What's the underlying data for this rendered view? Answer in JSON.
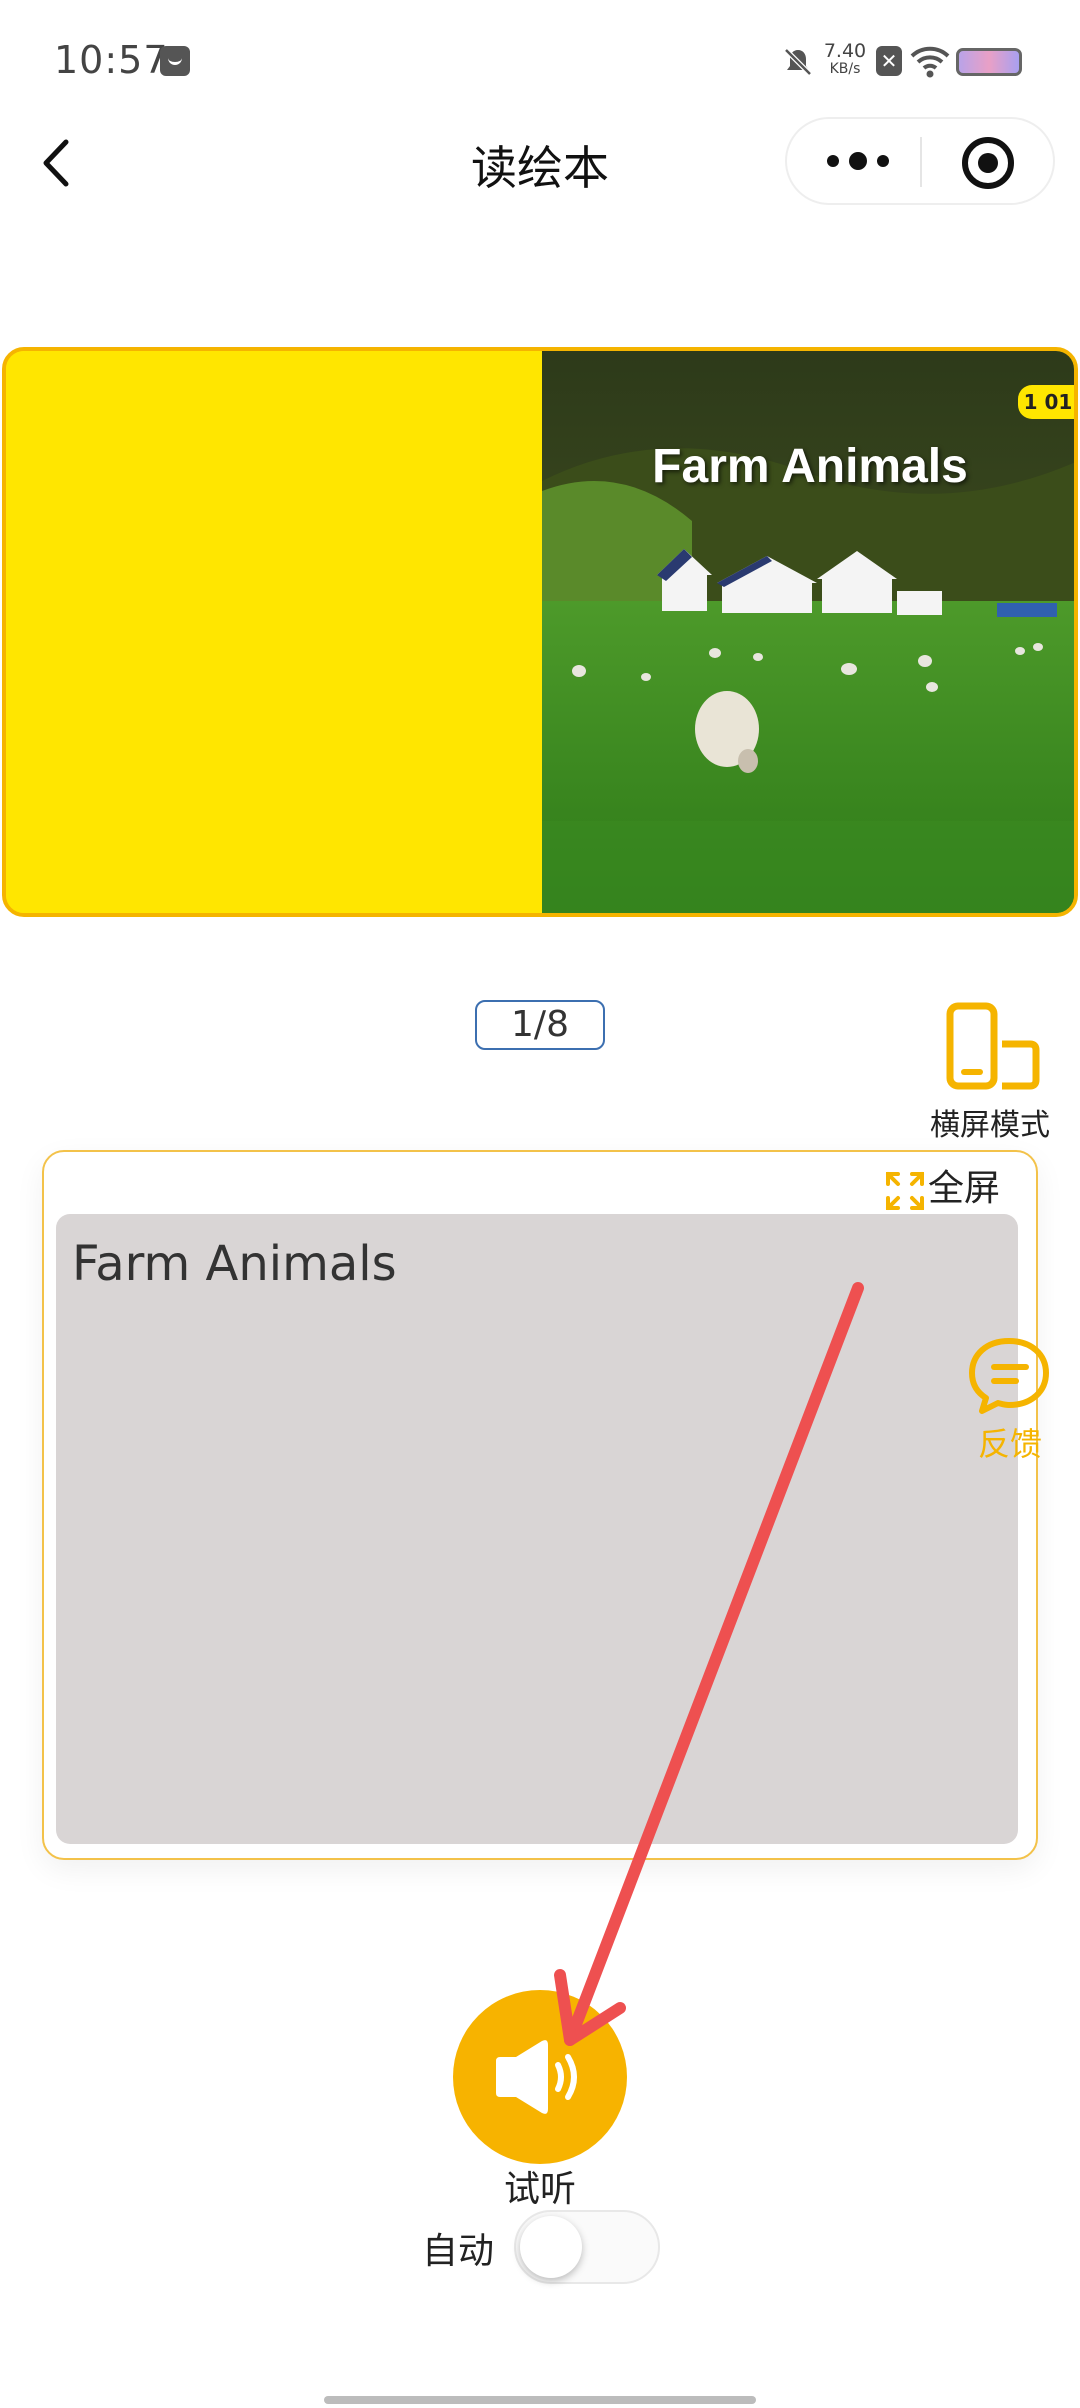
{
  "status_bar": {
    "time": "10:57",
    "network_speed_value": "7.40",
    "network_speed_unit": "KB/s",
    "icons": [
      "message-icon",
      "mute-bell-icon",
      "close-box-icon",
      "wifi-icon",
      "battery-icon"
    ]
  },
  "nav": {
    "title": "读绘本",
    "back_icon": "chevron-left-icon",
    "more_icon": "more-dots-icon",
    "close_icon": "target-circle-icon"
  },
  "book": {
    "cover_title": "Farm Animals",
    "badge": "1 01",
    "left_page_color": "#ffe600",
    "border_color": "#f5b400"
  },
  "page_indicator": "1/8",
  "landscape": {
    "label": "横屏模式",
    "icon": "phone-landscape-icon"
  },
  "text_card": {
    "fullscreen_label": "全屏",
    "fullscreen_icon": "expand-icon",
    "page_text": "Farm Animals"
  },
  "feedback": {
    "label": "反馈",
    "icon": "chat-bubble-icon"
  },
  "listen": {
    "label": "试听",
    "icon": "speaker-icon",
    "color": "#f7b300"
  },
  "auto": {
    "label": "自动",
    "enabled": false
  },
  "colors": {
    "accent": "#f5b400",
    "annotation_arrow": "#ee5050"
  }
}
